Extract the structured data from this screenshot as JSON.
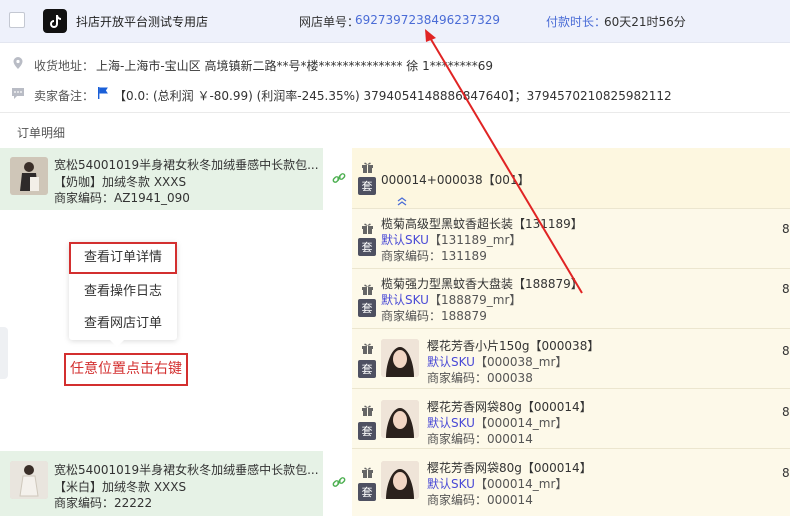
{
  "header": {
    "store_name": "抖店开放平台测试专用店",
    "order_no_label": "网店单号：",
    "order_no": "6927397238496237329",
    "pay_label": "付款时长：",
    "pay_value": "60天21时56分"
  },
  "address": {
    "label": "收货地址：",
    "value": "上海-上海市-宝山区 高境镇新二路**号*楼**************  徐 1********69"
  },
  "remark": {
    "label": "卖家备注：",
    "value": "【0.0:   (总利润 ￥-80.99)   (利润率-245.35%)  3794054148886847640】；3794570210825982112"
  },
  "detail_title": "订单明细",
  "left_items": [
    {
      "title": "宽松54001019半身裙女秋冬加绒垂感中长款包...",
      "variant": "【奶咖】加绒冬款 XXXS",
      "code_label": "商家编码：",
      "code": "AZ1941_090"
    },
    {
      "title": "宽松54001019半身裙女秋冬加绒垂感中长款包...",
      "variant": "【米白】加绒冬款 XXXS",
      "code_label": "商家编码：",
      "code": "22222"
    }
  ],
  "combo": {
    "badge": "套",
    "title": "000014+000038【001】"
  },
  "right_items": [
    {
      "name": "榄菊高级型黑蚊香超长装【131189】",
      "sku_label": "默认SKU",
      "sku_code": "【131189_mr】",
      "code_label": "商家编码：",
      "code": "131189",
      "qty": "8"
    },
    {
      "name": "榄菊强力型黑蚊香大盘装【188879】",
      "sku_label": "默认SKU",
      "sku_code": "【188879_mr】",
      "code_label": "商家编码：",
      "code": "188879",
      "qty": "8"
    },
    {
      "name": "樱花芳香小片150g【000038】",
      "sku_label": "默认SKU",
      "sku_code": "【000038_mr】",
      "code_label": "商家编码：",
      "code": "000038",
      "qty": "8"
    },
    {
      "name": "樱花芳香网袋80g【000014】",
      "sku_label": "默认SKU",
      "sku_code": "【000014_mr】",
      "code_label": "商家编码：",
      "code": "000014",
      "qty": "8"
    },
    {
      "name": "樱花芳香网袋80g【000014】",
      "sku_label": "默认SKU",
      "sku_code": "【000014_mr】",
      "code_label": "商家编码：",
      "code": "000014",
      "qty": "8"
    }
  ],
  "badge_tao": "套",
  "context_menu": {
    "items": [
      "查看订单详情",
      "查看操作日志",
      "查看网店订单"
    ]
  },
  "hint": "任意位置点击右键",
  "colors": {
    "accent": "#4a6cd6",
    "annotation_red": "#d32f2f",
    "left_card_bg": "#e6f2e6",
    "right_panel_bg": "#fdf9e9"
  }
}
